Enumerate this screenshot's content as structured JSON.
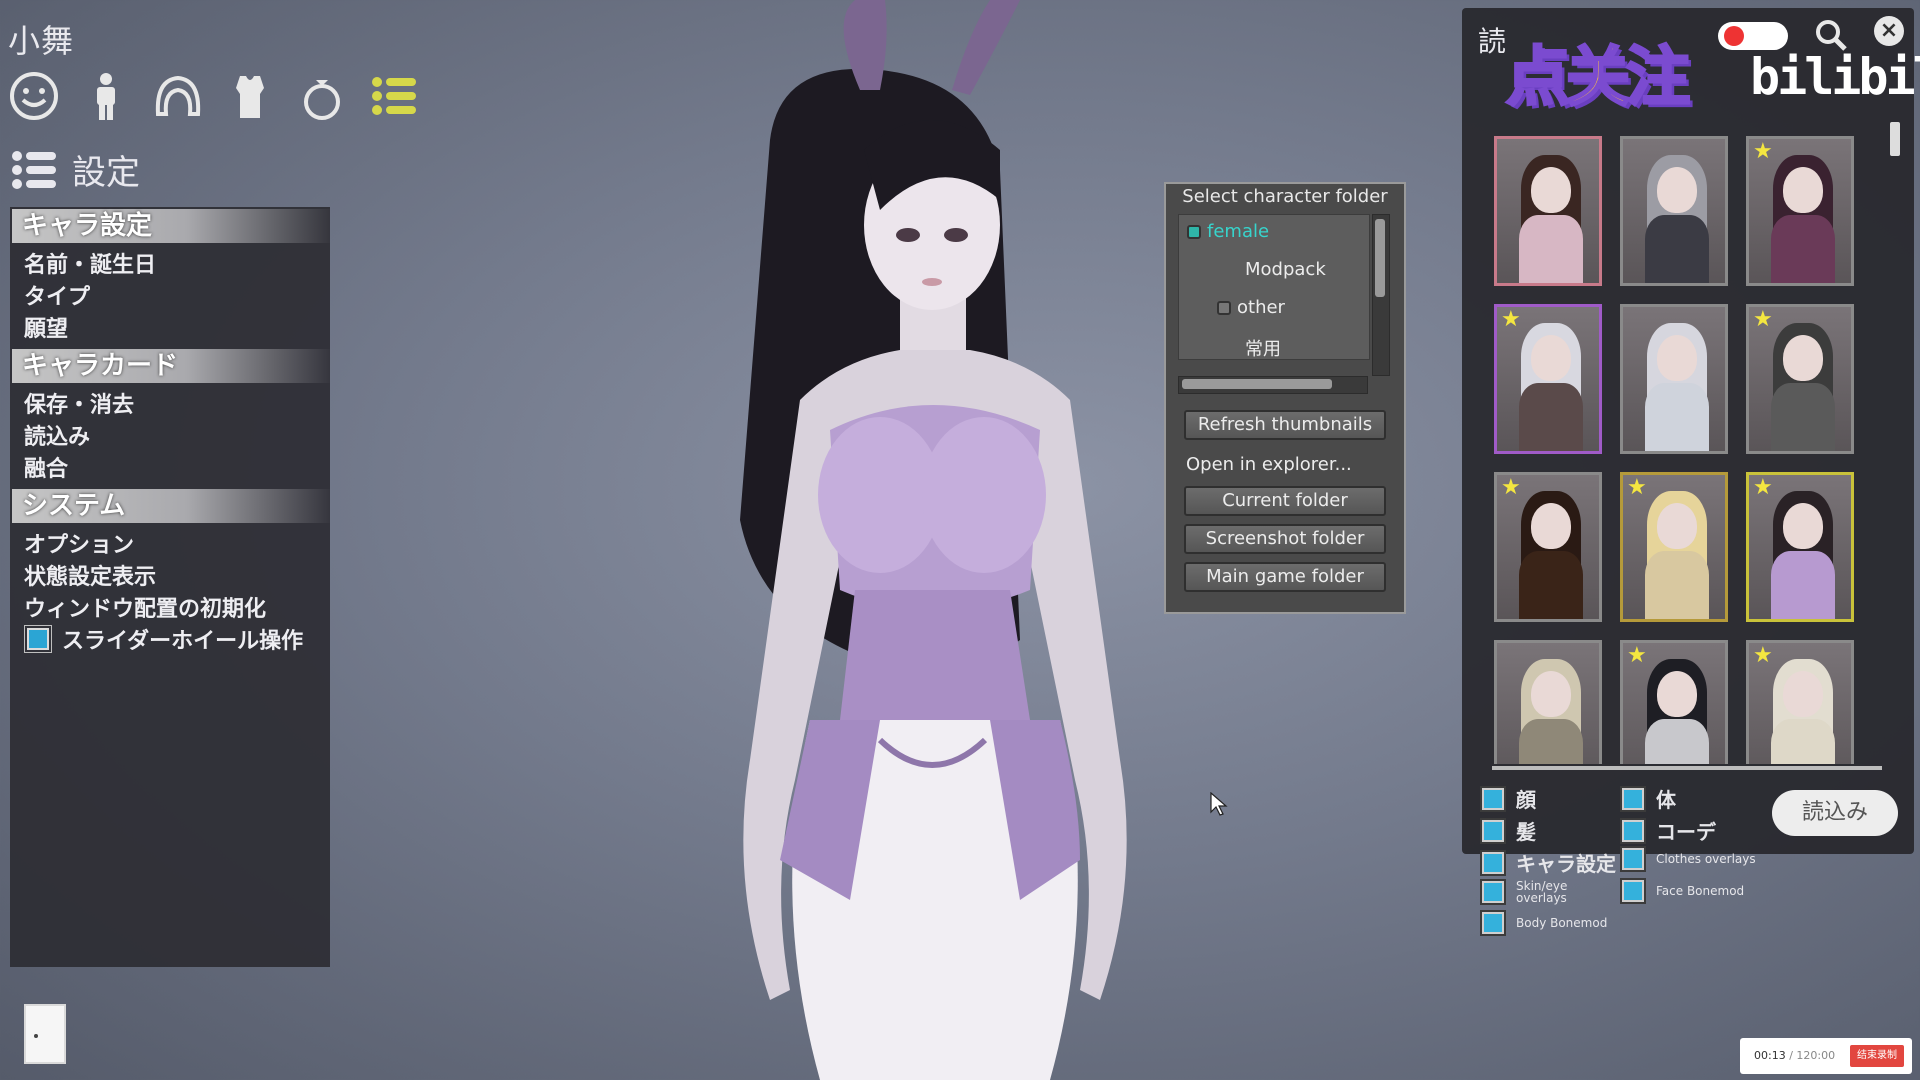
{
  "character_name": "小舞",
  "category_icons": [
    "face-icon",
    "body-icon",
    "hair-icon",
    "clothes-icon",
    "accessory-icon",
    "settings-list-icon"
  ],
  "settings_title": "設定",
  "left_menu": {
    "sections": [
      {
        "header": "キャラ設定",
        "items": [
          "名前・誕生日",
          "タイプ",
          "願望"
        ]
      },
      {
        "header": "キャラカード",
        "items": [
          "保存・消去",
          "読込み",
          "融合"
        ]
      },
      {
        "header": "システム",
        "items": [
          "オプション",
          "状態設定表示",
          "ウィンドウ配置の初期化"
        ]
      }
    ],
    "slider_wheel_label": "スライダーホイール操作",
    "slider_wheel_checked": true
  },
  "folder_dialog": {
    "title": "Select character folder",
    "tree": [
      {
        "label": "female",
        "selected": true
      },
      {
        "label": "Modpack",
        "selected": false
      },
      {
        "label": "other",
        "selected": false
      },
      {
        "label": "常用",
        "selected": false
      }
    ],
    "refresh_label": "Refresh thumbnails",
    "explorer_label": "Open in explorer...",
    "current_label": "Current folder",
    "screenshot_label": "Screenshot folder",
    "main_label": "Main game folder"
  },
  "right_panel": {
    "title": "読",
    "cards": [
      {
        "favorite": false,
        "border": "#c87a8a",
        "hair": "#3a2622",
        "outfit": "#d7b7c4"
      },
      {
        "favorite": false,
        "border": "#8a8a8a",
        "hair": "#9c9ca4",
        "outfit": "#3b3b44"
      },
      {
        "favorite": true,
        "border": "#8a8a8a",
        "hair": "#3a2230",
        "outfit": "#6a3a58"
      },
      {
        "favorite": true,
        "border": "#a05bc8",
        "hair": "#d8d8e0",
        "outfit": "#5a4a4a"
      },
      {
        "favorite": false,
        "border": "#8a8a8a",
        "hair": "#d6d6de",
        "outfit": "#cfd3dc"
      },
      {
        "favorite": true,
        "border": "#8a8a8a",
        "hair": "#3c3c3c",
        "outfit": "#5a5a5a"
      },
      {
        "favorite": true,
        "border": "#8a8a8a",
        "hair": "#2a1a14",
        "outfit": "#3a2418"
      },
      {
        "favorite": true,
        "border": "#b59a3a",
        "hair": "#e6d49a",
        "outfit": "#d8c8a0"
      },
      {
        "favorite": true,
        "border": "#c9c23a",
        "hair": "#2a2226",
        "outfit": "#b79ad0"
      },
      {
        "favorite": false,
        "border": "#8a8a8a",
        "hair": "#cfc7b0",
        "outfit": "#8f8878"
      },
      {
        "favorite": true,
        "border": "#8a8a8a",
        "hair": "#1e1e24",
        "outfit": "#c8c8cc"
      },
      {
        "favorite": true,
        "border": "#8a8a8a",
        "hair": "#e2ddd0",
        "outfit": "#ded8c8"
      }
    ],
    "options": [
      {
        "label": "顔",
        "checked": true
      },
      {
        "label": "体",
        "checked": true
      },
      {
        "label": "髪",
        "checked": true
      },
      {
        "label": "コーデ",
        "checked": true
      },
      {
        "label": "キャラ設定",
        "checked": true
      },
      {
        "label": "Clothes overlays",
        "checked": true
      },
      {
        "label": "Skin/eye overlays",
        "checked": true
      },
      {
        "label": "Face Bonemod",
        "checked": true
      },
      {
        "label": "Body Bonemod",
        "checked": true
      }
    ],
    "load_button": "読込み"
  },
  "overlay": {
    "sticker_text": "点关注",
    "logo_text": "bilibili"
  },
  "recording": {
    "elapsed": "00:13",
    "total": "/ 120:00",
    "stop_label": "结束录制"
  },
  "colors": {
    "checkbox": "#34b1dc",
    "selected_folder": "#37d4cc",
    "stop_button": "#e2463f"
  }
}
